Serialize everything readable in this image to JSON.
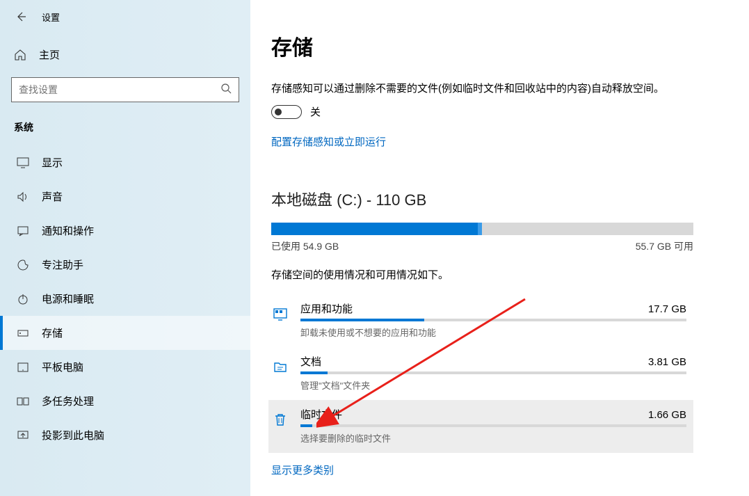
{
  "header": {
    "settings_label": "设置",
    "home_label": "主页",
    "search_placeholder": "查找设置"
  },
  "sidebar": {
    "section": "系统",
    "items": [
      {
        "icon": "display",
        "label": "显示"
      },
      {
        "icon": "sound",
        "label": "声音"
      },
      {
        "icon": "notify",
        "label": "通知和操作"
      },
      {
        "icon": "focus",
        "label": "专注助手"
      },
      {
        "icon": "power",
        "label": "电源和睡眠"
      },
      {
        "icon": "storage",
        "label": "存储",
        "selected": true
      },
      {
        "icon": "tablet",
        "label": "平板电脑"
      },
      {
        "icon": "multitask",
        "label": "多任务处理"
      },
      {
        "icon": "project",
        "label": "投影到此电脑"
      }
    ]
  },
  "main": {
    "title": "存储",
    "storage_sense_desc": "存储感知可以通过删除不需要的文件(例如临时文件和回收站中的内容)自动释放空间。",
    "toggle_label": "关",
    "configure_link": "配置存储感知或立即运行",
    "disk": {
      "title": "本地磁盘 (C:) - 110 GB",
      "used_label": "已使用 54.9 GB",
      "free_label": "55.7 GB 可用",
      "used_percent_primary": 49,
      "used_percent_secondary": 1
    },
    "usage_desc": "存储空间的使用情况和可用情况如下。",
    "categories": [
      {
        "icon": "apps",
        "title": "应用和功能",
        "size": "17.7 GB",
        "fill_percent": 32,
        "hint": "卸载未使用或不想要的应用和功能"
      },
      {
        "icon": "docs",
        "title": "文档",
        "size": "3.81 GB",
        "fill_percent": 7,
        "hint": "管理\"文档\"文件夹"
      },
      {
        "icon": "trash",
        "title": "临时文件",
        "size": "1.66 GB",
        "fill_percent": 3,
        "hint": "选择要删除的临时文件",
        "highlighted": true
      }
    ],
    "show_more": "显示更多类别"
  }
}
